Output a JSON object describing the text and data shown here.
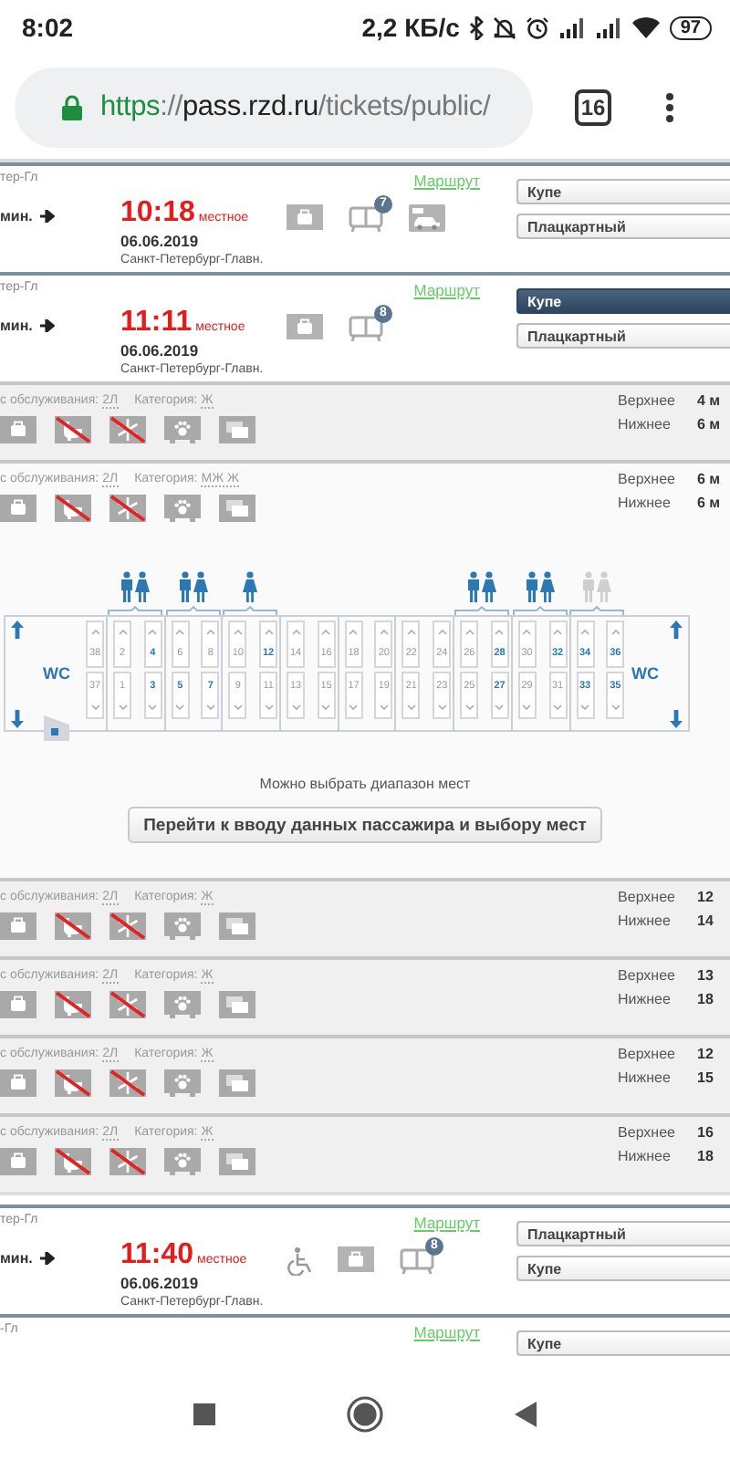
{
  "status_bar": {
    "time": "8:02",
    "speed": "2,2 КБ/с",
    "battery": "97"
  },
  "browser": {
    "url": {
      "scheme": "https",
      "separator": "://",
      "host": "pass.rzd.ru",
      "path": "/tickets/public/"
    },
    "tab_count": "16"
  },
  "trains": [
    {
      "origin": "тер-Гл",
      "route": "Маршрут",
      "duration": "мин.",
      "time": "10:18",
      "time_note": "местное",
      "date": "06.06.2019",
      "station": "Санкт-Петербург-Главн.",
      "services": [
        {
          "kind": "bag"
        },
        {
          "kind": "train",
          "badge": "7"
        },
        {
          "kind": "car"
        }
      ],
      "classes": [
        {
          "label": "Купе",
          "selected": false
        },
        {
          "label": "Плацкартный",
          "selected": false
        }
      ]
    },
    {
      "origin": "тер-Гл",
      "route": "Маршрут",
      "duration": "мин.",
      "time": "11:11",
      "time_note": "местное",
      "date": "06.06.2019",
      "station": "Санкт-Петербург-Главн.",
      "services": [
        {
          "kind": "bag"
        },
        {
          "kind": "train",
          "badge": "8"
        }
      ],
      "classes": [
        {
          "label": "Купе",
          "selected": true
        },
        {
          "label": "Плацкартный",
          "selected": false
        }
      ],
      "cars": [
        {
          "service_label": "с обслуживания:",
          "service_class": "2Л",
          "category_label": "Категория:",
          "category": "Ж",
          "expanded": false,
          "amenities": [
            {
              "kind": "bag",
              "crossed": false
            },
            {
              "kind": "wc",
              "crossed": true
            },
            {
              "kind": "snowflake",
              "crossed": true
            },
            {
              "kind": "pets",
              "crossed": false
            },
            {
              "kind": "screens",
              "crossed": false
            }
          ],
          "berths": [
            {
              "label": "Верхнее",
              "count": "4 м"
            },
            {
              "label": "Нижнее",
              "count": "6 м"
            }
          ]
        },
        {
          "service_label": "с обслуживания:",
          "service_class": "2Л",
          "category_label": "Категория:",
          "category": "МЖ Ж",
          "expanded": true,
          "amenities": [
            {
              "kind": "bag",
              "crossed": false
            },
            {
              "kind": "wc",
              "crossed": true
            },
            {
              "kind": "snowflake",
              "crossed": true
            },
            {
              "kind": "pets",
              "crossed": false
            },
            {
              "kind": "screens",
              "crossed": false
            }
          ],
          "berths": [
            {
              "label": "Верхнее",
              "count": "6 м"
            },
            {
              "label": "Нижнее",
              "count": "6 м"
            }
          ],
          "scheme": {
            "left_wc": "WC",
            "right_wc": "WC",
            "extra_column": {
              "upper": {
                "number": "38",
                "free": false
              },
              "lower": {
                "number": "37",
                "free": false
              }
            },
            "compartments": [
              {
                "columns": [
                  {
                    "upper": {
                      "number": "2",
                      "free": false
                    },
                    "lower": {
                      "number": "1",
                      "free": false
                    }
                  },
                  {
                    "upper": {
                      "number": "4",
                      "free": true
                    },
                    "lower": {
                      "number": "3",
                      "free": true
                    }
                  }
                ],
                "occupants": [
                  {
                    "kind": "male",
                    "dimmed": false
                  },
                  {
                    "kind": "female",
                    "dimmed": false
                  }
                ]
              },
              {
                "columns": [
                  {
                    "upper": {
                      "number": "6",
                      "free": false
                    },
                    "lower": {
                      "number": "5",
                      "free": true
                    }
                  },
                  {
                    "upper": {
                      "number": "8",
                      "free": false
                    },
                    "lower": {
                      "number": "7",
                      "free": true
                    }
                  }
                ],
                "occupants": [
                  {
                    "kind": "male",
                    "dimmed": false
                  },
                  {
                    "kind": "female",
                    "dimmed": false
                  }
                ]
              },
              {
                "columns": [
                  {
                    "upper": {
                      "number": "10",
                      "free": false
                    },
                    "lower": {
                      "number": "9",
                      "free": false
                    }
                  },
                  {
                    "upper": {
                      "number": "12",
                      "free": true
                    },
                    "lower": {
                      "number": "11",
                      "free": false
                    }
                  }
                ],
                "occupants": [
                  {
                    "kind": "female",
                    "dimmed": false
                  }
                ]
              },
              {
                "columns": [
                  {
                    "upper": {
                      "number": "14",
                      "free": false
                    },
                    "lower": {
                      "number": "13",
                      "free": false
                    }
                  },
                  {
                    "upper": {
                      "number": "16",
                      "free": false
                    },
                    "lower": {
                      "number": "15",
                      "free": false
                    }
                  }
                ]
              },
              {
                "columns": [
                  {
                    "upper": {
                      "number": "18",
                      "free": false
                    },
                    "lower": {
                      "number": "17",
                      "free": false
                    }
                  },
                  {
                    "upper": {
                      "number": "20",
                      "free": false
                    },
                    "lower": {
                      "number": "19",
                      "free": false
                    }
                  }
                ]
              },
              {
                "columns": [
                  {
                    "upper": {
                      "number": "22",
                      "free": false
                    },
                    "lower": {
                      "number": "21",
                      "free": false
                    }
                  },
                  {
                    "upper": {
                      "number": "24",
                      "free": false
                    },
                    "lower": {
                      "number": "23",
                      "free": false
                    }
                  }
                ]
              },
              {
                "columns": [
                  {
                    "upper": {
                      "number": "26",
                      "free": false
                    },
                    "lower": {
                      "number": "25",
                      "free": false
                    }
                  },
                  {
                    "upper": {
                      "number": "28",
                      "free": true
                    },
                    "lower": {
                      "number": "27",
                      "free": true
                    }
                  }
                ],
                "occupants": [
                  {
                    "kind": "male",
                    "dimmed": false
                  },
                  {
                    "kind": "female",
                    "dimmed": false
                  }
                ]
              },
              {
                "columns": [
                  {
                    "upper": {
                      "number": "30",
                      "free": false
                    },
                    "lower": {
                      "number": "29",
                      "free": false
                    }
                  },
                  {
                    "upper": {
                      "number": "32",
                      "free": true
                    },
                    "lower": {
                      "number": "31",
                      "free": false
                    }
                  }
                ],
                "occupants": [
                  {
                    "kind": "male",
                    "dimmed": false
                  },
                  {
                    "kind": "female",
                    "dimmed": false
                  }
                ]
              },
              {
                "columns": [
                  {
                    "upper": {
                      "number": "34",
                      "free": true
                    },
                    "lower": {
                      "number": "33",
                      "free": true
                    }
                  },
                  {
                    "upper": {
                      "number": "36",
                      "free": true
                    },
                    "lower": {
                      "number": "35",
                      "free": true
                    }
                  }
                ],
                "occupants": [
                  {
                    "kind": "male",
                    "dimmed": true
                  },
                  {
                    "kind": "female",
                    "dimmed": true
                  }
                ]
              }
            ]
          },
          "hint": "Можно выбрать диапазон мест",
          "action": "Перейти к вводу данных пассажира и выбору мест"
        },
        {
          "service_label": "с обслуживания:",
          "service_class": "2Л",
          "category_label": "Категория:",
          "category": "Ж",
          "expanded": false,
          "amenities": [
            {
              "kind": "bag",
              "crossed": false
            },
            {
              "kind": "wc",
              "crossed": true
            },
            {
              "kind": "snowflake",
              "crossed": true
            },
            {
              "kind": "pets",
              "crossed": false
            },
            {
              "kind": "screens",
              "crossed": false
            }
          ],
          "berths": [
            {
              "label": "Верхнее",
              "count": "12"
            },
            {
              "label": "Нижнее",
              "count": "14"
            }
          ]
        },
        {
          "service_label": "с обслуживания:",
          "service_class": "2Л",
          "category_label": "Категория:",
          "category": "Ж",
          "expanded": false,
          "amenities": [
            {
              "kind": "bag",
              "crossed": false
            },
            {
              "kind": "wc",
              "crossed": true
            },
            {
              "kind": "snowflake",
              "crossed": true
            },
            {
              "kind": "pets",
              "crossed": false
            },
            {
              "kind": "screens",
              "crossed": false
            }
          ],
          "berths": [
            {
              "label": "Верхнее",
              "count": "13"
            },
            {
              "label": "Нижнее",
              "count": "18"
            }
          ]
        },
        {
          "service_label": "с обслуживания:",
          "service_class": "2Л",
          "category_label": "Категория:",
          "category": "Ж",
          "expanded": false,
          "amenities": [
            {
              "kind": "bag",
              "crossed": false
            },
            {
              "kind": "wc",
              "crossed": true
            },
            {
              "kind": "snowflake",
              "crossed": true
            },
            {
              "kind": "pets",
              "crossed": false
            },
            {
              "kind": "screens",
              "crossed": false
            }
          ],
          "berths": [
            {
              "label": "Верхнее",
              "count": "12"
            },
            {
              "label": "Нижнее",
              "count": "15"
            }
          ]
        },
        {
          "service_label": "с обслуживания:",
          "service_class": "2Л",
          "category_label": "Категория:",
          "category": "Ж",
          "expanded": false,
          "amenities": [
            {
              "kind": "bag",
              "crossed": false
            },
            {
              "kind": "wc",
              "crossed": true
            },
            {
              "kind": "snowflake",
              "crossed": true
            },
            {
              "kind": "pets",
              "crossed": false
            },
            {
              "kind": "screens",
              "crossed": false
            }
          ],
          "berths": [
            {
              "label": "Верхнее",
              "count": "16"
            },
            {
              "label": "Нижнее",
              "count": "18"
            }
          ]
        }
      ]
    },
    {
      "origin": "тер-Гл",
      "route": "Маршрут",
      "duration": "мин.",
      "time": "11:40",
      "time_note": "местное",
      "date": "06.06.2019",
      "station": "Санкт-Петербург-Главн.",
      "services": [
        {
          "kind": "wheelchair"
        },
        {
          "kind": "bag"
        },
        {
          "kind": "train",
          "badge": "8"
        }
      ],
      "classes": [
        {
          "label": "Плацкартный",
          "selected": false
        },
        {
          "label": "Купе",
          "selected": false
        }
      ]
    },
    {
      "origin": "-Гл",
      "route": "Маршрут",
      "classes": [
        {
          "label": "Купе",
          "selected": false
        }
      ]
    }
  ]
}
